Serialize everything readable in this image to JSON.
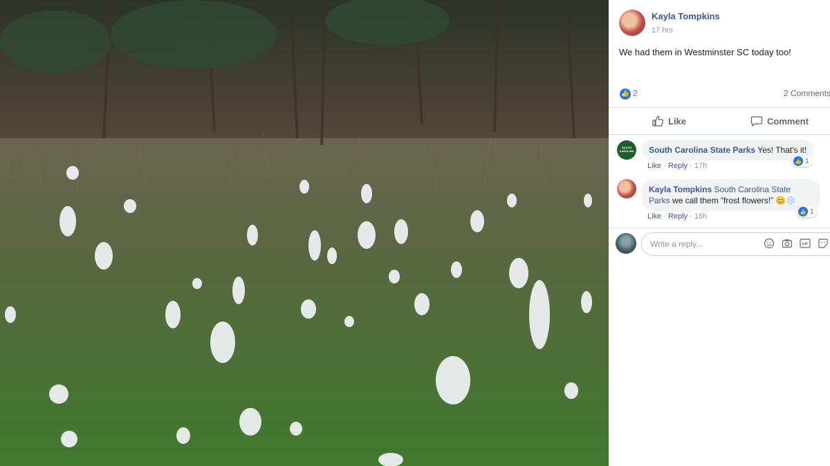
{
  "post": {
    "author": "Kayla Tompkins",
    "time": "17 hrs",
    "text": "We had them in Westminster SC today too!",
    "reactions_count": "2",
    "comments_count": "2 Comments",
    "like_label": "Like",
    "comment_label": "Comment"
  },
  "comments": [
    {
      "author": "South Carolina State Parks",
      "text": "Yes! That's it!",
      "like": "Like",
      "reply": "Reply",
      "time": "17h",
      "reactions": "1",
      "avatar_text": "SOUTH CAROLINA"
    },
    {
      "author": "Kayla Tompkins",
      "tag": "South Carolina State Parks",
      "text": "we call them “frost flowers!” 😊❄️",
      "like": "Like",
      "reply": "Reply",
      "time": "16h",
      "reactions": "1"
    }
  ],
  "reply_box": {
    "placeholder": "Write a reply...",
    "icons": [
      "emoji-icon",
      "camera-icon",
      "gif-icon",
      "sticker-icon"
    ]
  },
  "colors": {
    "link": "#385898",
    "like_blue": "#1877f2",
    "muted": "#90949c",
    "bubble": "#f2f3f5"
  }
}
